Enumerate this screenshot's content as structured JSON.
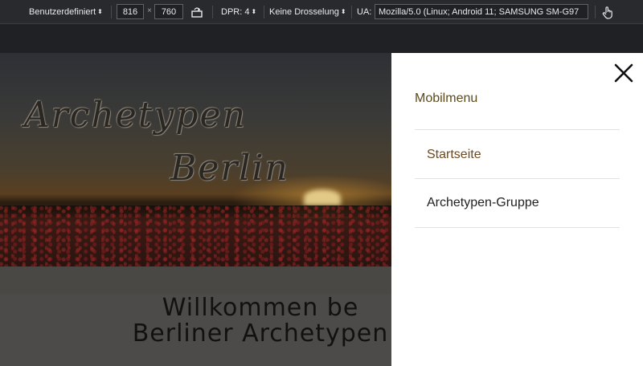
{
  "toolbar": {
    "device": "Benutzerdefiniert",
    "width": "816",
    "times": "×",
    "height": "760",
    "dpr": "DPR: 4",
    "throttle": "Keine Drosselung",
    "ua_label": "UA:",
    "ua_value": "Mozilla/5.0 (Linux; Android 11; SAMSUNG SM-G97",
    "icons": {
      "rotate": "rotate-icon",
      "touch": "touch-icon"
    }
  },
  "site": {
    "logo_line1": "Archetypen",
    "logo_line2": "Berlin",
    "welcome_line1": "Willkommen be",
    "welcome_line2": "Berliner Archetypen"
  },
  "drawer": {
    "title": "Mobilmenu",
    "items": [
      {
        "label": "Startseite",
        "color": "#6b4a22"
      },
      {
        "label": "Archetypen-Gruppe",
        "color": "#222222"
      }
    ],
    "close_icon": "close-icon"
  },
  "colors": {
    "toolbar_bg": "#292a2d",
    "page_dim": "#4c4b49",
    "drawer_bg": "#ffffff",
    "title_color": "#5a4b1c"
  }
}
